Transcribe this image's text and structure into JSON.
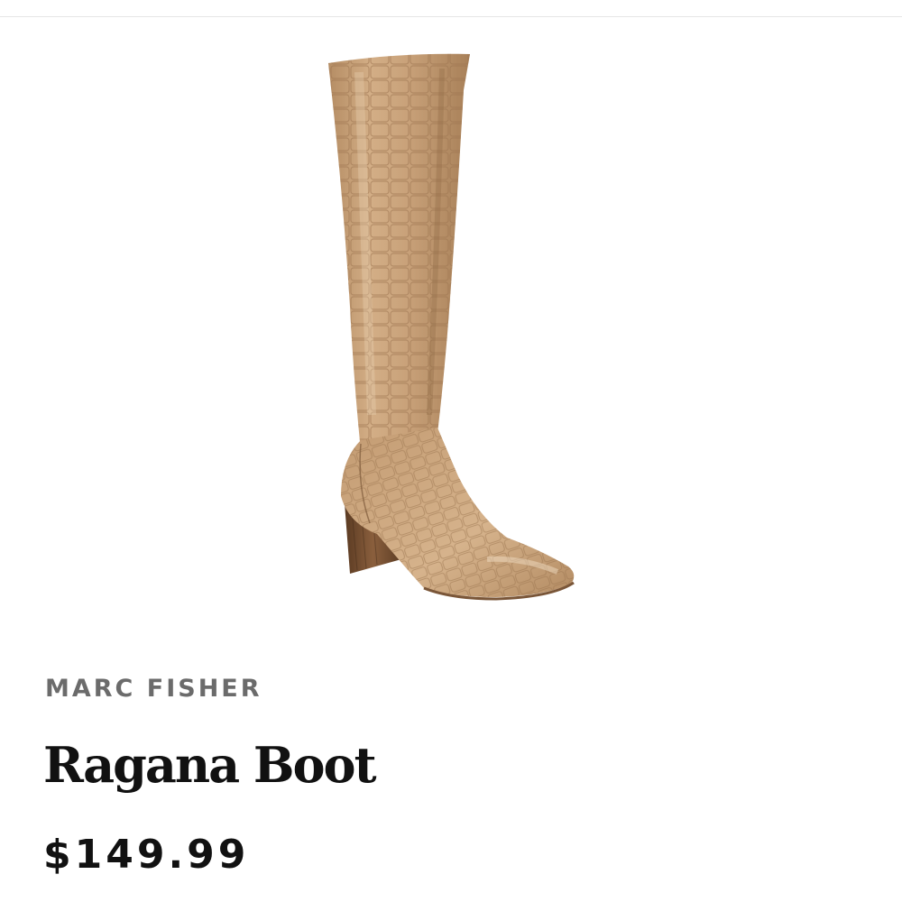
{
  "product": {
    "brand": "MARC FISHER",
    "name": "Ragana Boot",
    "price": "$149.99",
    "image_alt": "Ragana Boot",
    "image_icon": "tall-croc-embossed-boot",
    "colors": {
      "boot_body": "#c9a27a",
      "boot_shadow": "#a57d55",
      "heel_wood": "#6e4a2e",
      "brand_text": "#6b6b6b",
      "title_text": "#111111"
    }
  }
}
